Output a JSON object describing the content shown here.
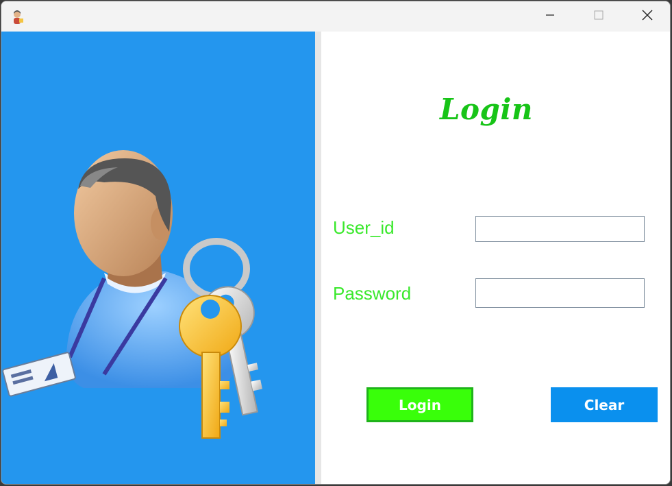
{
  "window": {
    "controls": {
      "minimize_icon": "minimize-icon",
      "maximize_icon": "maximize-icon",
      "close_icon": "close-icon"
    }
  },
  "illustration": {
    "icon": "user-with-keys-icon"
  },
  "login_form": {
    "title": "Login",
    "user_id_label": "User_id",
    "user_id_value": "",
    "password_label": "Password",
    "password_value": "",
    "login_button": "Login",
    "clear_button": "Clear"
  },
  "colors": {
    "left_panel": "#2496ee",
    "title": "#17c417",
    "labels": "#39e82b",
    "login_button": "#39ff0a",
    "clear_button": "#0a90ee"
  }
}
